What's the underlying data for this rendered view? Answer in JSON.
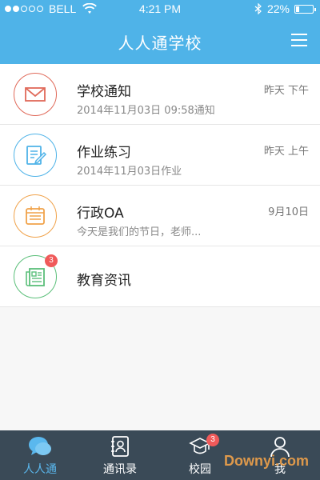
{
  "status_bar": {
    "carrier": "BELL",
    "time": "4:21 PM",
    "battery": "22%",
    "battery_level": 0.22,
    "signal_bars": 2,
    "icons": [
      "wifi-icon",
      "bluetooth-icon",
      "battery-icon"
    ]
  },
  "header": {
    "title": "人人通学校",
    "menu_icon": "menu-icon"
  },
  "list": [
    {
      "title": "学校通知",
      "subtitle": "2014年11月03日  09:58通知",
      "time": "昨天 下午",
      "icon": "envelope-icon",
      "color": "#e06a5a"
    },
    {
      "title": "作业练习",
      "subtitle": "2014年11月03日作业",
      "time": "昨天 上午",
      "icon": "homework-icon",
      "color": "#4fb3e8"
    },
    {
      "title": "行政OA",
      "subtitle": "今天是我们的节日，老师...",
      "time": "9月10日",
      "icon": "calendar-icon",
      "color": "#f0a24a"
    },
    {
      "title": "教育资讯",
      "badge": "3",
      "icon": "news-icon",
      "color": "#5bbf7a"
    }
  ],
  "tabbar": {
    "tabs": [
      {
        "label": "人人通",
        "icon": "chat-bubbles-icon",
        "active": true
      },
      {
        "label": "通讯录",
        "icon": "contacts-icon",
        "active": false
      },
      {
        "label": "校园",
        "icon": "campus-icon",
        "active": false,
        "badge": "3"
      },
      {
        "label": "我",
        "icon": "person-icon",
        "active": false
      }
    ]
  },
  "watermark": "Downyi.com",
  "colors": {
    "header": "#4fb3e8",
    "tabbar": "#3a4a57",
    "active_tab": "#5ab8ee",
    "badge": "#f05a5a"
  }
}
